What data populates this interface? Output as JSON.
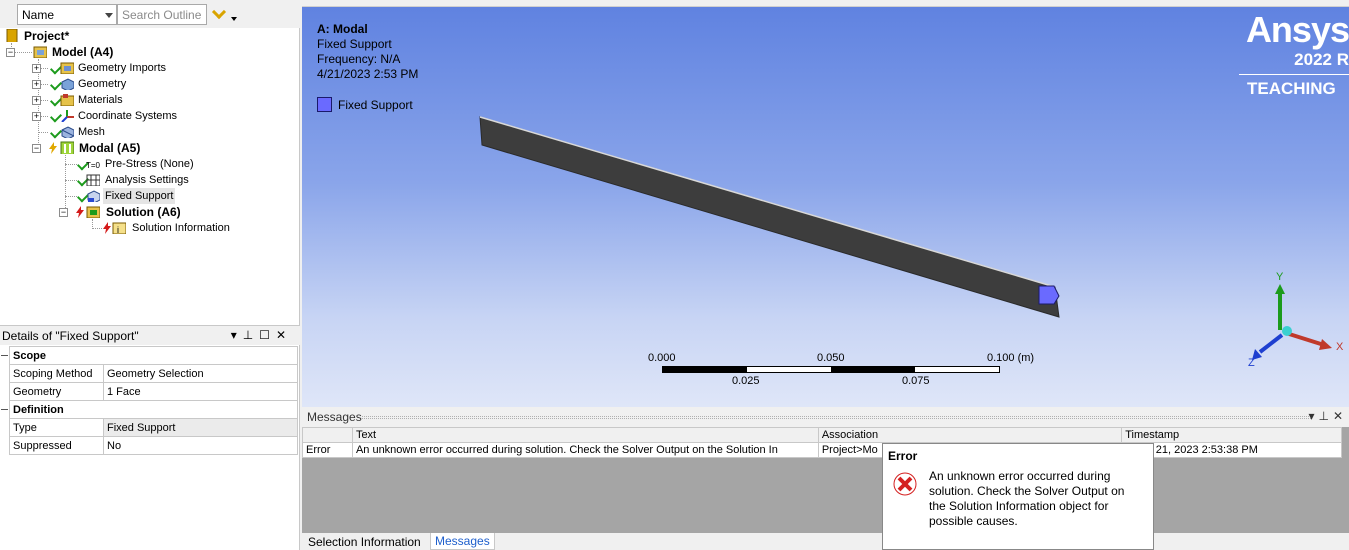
{
  "outline": {
    "filter_value": "Name",
    "search_placeholder": "Search Outline",
    "tree": [
      {
        "label": "Project*",
        "bold": true
      },
      {
        "label": "Model (A4)",
        "bold": true
      },
      {
        "label": "Geometry Imports"
      },
      {
        "label": "Geometry"
      },
      {
        "label": "Materials"
      },
      {
        "label": "Coordinate Systems"
      },
      {
        "label": "Mesh"
      },
      {
        "label": "Modal (A5)",
        "bold": true
      },
      {
        "label": "Pre-Stress (None)"
      },
      {
        "label": "Analysis Settings"
      },
      {
        "label": "Fixed Support"
      },
      {
        "label": "Solution (A6)",
        "bold": true
      },
      {
        "label": "Solution Information"
      }
    ]
  },
  "details": {
    "title": "Details of \"Fixed Support\"",
    "categories": [
      {
        "name": "Scope",
        "rows": [
          {
            "key": "Scoping Method",
            "value": "Geometry Selection"
          },
          {
            "key": "Geometry",
            "value": "1 Face"
          }
        ]
      },
      {
        "name": "Definition",
        "rows": [
          {
            "key": "Type",
            "value": "Fixed Support"
          },
          {
            "key": "Suppressed",
            "value": "No"
          }
        ]
      }
    ]
  },
  "viewport": {
    "title": "A: Modal",
    "subtitle": "Fixed Support",
    "frequency": "Frequency: N/A",
    "date": "4/21/2023 2:53 PM",
    "legend_label": "Fixed Support",
    "legend_color": "#6a6aff",
    "brand": "Ansys",
    "version": "2022 R",
    "edition": "TEACHING",
    "scale": {
      "top_labels": [
        "0.000",
        "0.050",
        "0.100 (m)"
      ],
      "bottom_labels": [
        "0.025",
        "0.075"
      ]
    },
    "axes": {
      "x": "X",
      "y": "Y",
      "z": "Z"
    }
  },
  "messages": {
    "title": "Messages",
    "columns": [
      "Text",
      "Association",
      "Timestamp"
    ],
    "rows": [
      {
        "severity": "Error",
        "text": "An unknown error occurred during solution.  Check the Solver Output on the Solution In",
        "association": "Project>Mo",
        "timestamp": ", April 21, 2023 2:53:38 PM"
      }
    ]
  },
  "tabs": [
    "Selection Information",
    "Messages"
  ],
  "error_popup": {
    "title": "Error",
    "message": "An unknown error occurred during solution. Check the Solver Output on the Solution Information object for possible causes."
  }
}
